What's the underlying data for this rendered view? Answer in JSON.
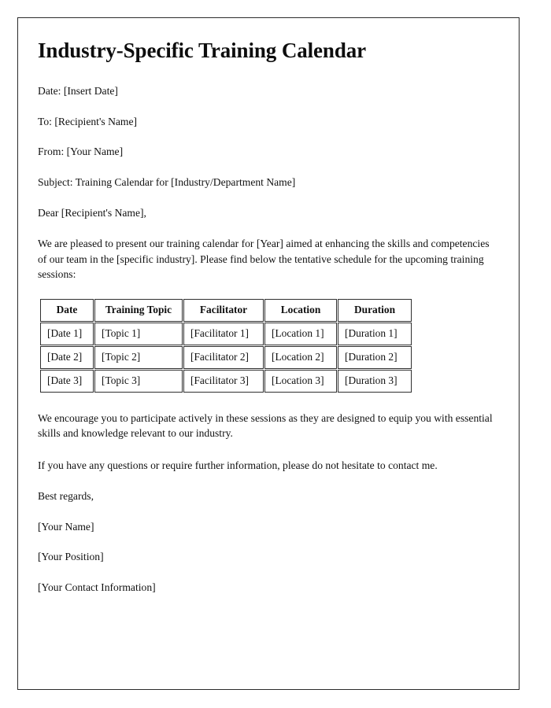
{
  "document": {
    "title": "Industry-Specific Training Calendar",
    "page_border_color": "#2b2b2b",
    "text_color": "#111111",
    "background_color": "#ffffff"
  },
  "header": {
    "date_line": "Date: [Insert Date]",
    "to_line": "To: [Recipient's Name]",
    "from_line": "From: [Your Name]",
    "subject_line": "Subject: Training Calendar for [Industry/Department Name]"
  },
  "salutation": "Dear [Recipient's Name],",
  "body": {
    "intro": "We are pleased to present our training calendar for [Year] aimed at enhancing the skills and competencies of our team in the [specific industry]. Please find below the tentative schedule for the upcoming training sessions:",
    "encourage": "We encourage you to participate actively in these sessions as they are designed to equip you with essential skills and knowledge relevant to our industry.",
    "questions": "If you have any questions or require further information, please do not hesitate to contact me."
  },
  "table": {
    "columns": [
      "Date",
      "Training Topic",
      "Facilitator",
      "Location",
      "Duration"
    ],
    "rows": [
      [
        "[Date 1]",
        "[Topic 1]",
        "[Facilitator 1]",
        "[Location 1]",
        "[Duration 1]"
      ],
      [
        "[Date 2]",
        "[Topic 2]",
        "[Facilitator 2]",
        "[Location 2]",
        "[Duration 2]"
      ],
      [
        "[Date 3]",
        "[Topic 3]",
        "[Facilitator 3]",
        "[Location 3]",
        "[Duration 3]"
      ]
    ]
  },
  "signature": {
    "closing": "Best regards,",
    "name": "[Your Name]",
    "position": "[Your Position]",
    "contact": "[Your Contact Information]"
  }
}
